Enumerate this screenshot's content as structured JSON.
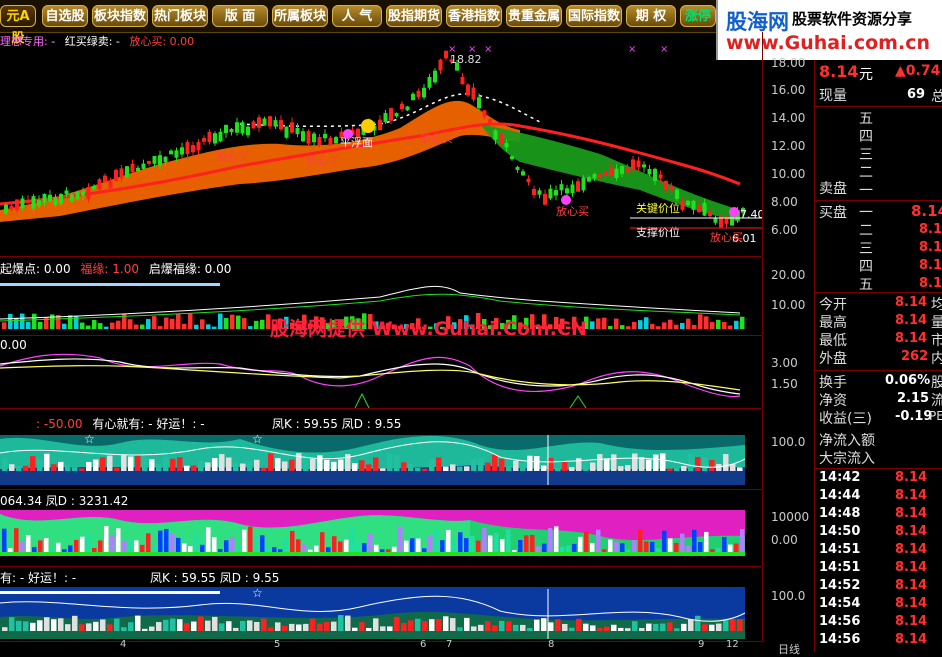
{
  "tabs": [
    "元A股",
    "自选股",
    "板块指数",
    "热门板块",
    "版 面",
    "所属板块",
    "人 气",
    "股指期货",
    "香港指数",
    "贵重金属",
    "国际指数",
    "期 权",
    "涨停"
  ],
  "logo": {
    "main": "股海网",
    "sub": "股票软件资源分享",
    "url": "www.Guhai.com.cn"
  },
  "main_chart": {
    "header": {
      "name": "理想专用:",
      "sep": "-",
      "item1": "红买绿卖:",
      "item1_val": "-",
      "item2": "放心买:",
      "item2_val": "0.00"
    },
    "y_ticks": [
      "18.00",
      "16.00",
      "14.00",
      "12.00",
      "10.00",
      "8.00",
      "6.00"
    ],
    "labels": {
      "peak": "18.82",
      "low": "6.01",
      "ping_fu_mian": "平浮面",
      "support": "支撑价位",
      "key": "关键价位",
      "key_val": "7.40",
      "buy1": "放心买",
      "buy2": "放心买",
      "buy3": "放心买",
      "buy4": "放心买",
      "buy5": "放心买"
    }
  },
  "panel2": {
    "h1": "起爆点: 0.00",
    "h2": "福缘: 1.00",
    "h3": "启爆福缘: 0.00",
    "y_ticks": [
      "20.00",
      "10.00"
    ]
  },
  "panel3": {
    "h1": "0.00",
    "y_ticks": [
      "3.00",
      "1.50"
    ]
  },
  "panel4": {
    "h1": ": -50.00",
    "h2": "有心就有: - 好运！: -",
    "h3": "凤K : 59.55  凤D : 9.55",
    "y_ticks": [
      "100.0"
    ]
  },
  "panel5": {
    "h1": "064.34  凤D : 3231.42",
    "y_ticks": [
      "10000",
      "0.00"
    ]
  },
  "panel6": {
    "h1": "有: - 好运！: -",
    "h2": "凤K : 59.55  凤D : 9.55",
    "y_ticks": [
      "100.0"
    ]
  },
  "watermark": "股海网提供 Www.Guhai.Com.CN",
  "x_axis": [
    "4",
    "5",
    "6",
    "7",
    "8",
    "9",
    "12"
  ],
  "bottom_right": "日线",
  "quote": {
    "price": "8.14",
    "price_unit": "元",
    "change": "▲0.74",
    "volume_label": "现量",
    "volume": "69",
    "volume_suffix": "总",
    "sell_levels": [
      "五",
      "四",
      "三",
      "二",
      "一"
    ],
    "sell_label": "卖盘",
    "buy_label": "买盘",
    "buy_levels": [
      "一",
      "二",
      "三",
      "四",
      "五"
    ],
    "buy_prices": [
      "8.14",
      "8.1",
      "8.1",
      "8.1",
      "8.1"
    ],
    "stats": [
      {
        "label": "今开",
        "value": "8.14",
        "suffix": "均"
      },
      {
        "label": "最高",
        "value": "8.14",
        "suffix": "量"
      },
      {
        "label": "最低",
        "value": "8.14",
        "suffix": "市"
      },
      {
        "label": "外盘",
        "value": "262",
        "suffix": "内"
      },
      {
        "label": "换手",
        "value": "0.06%",
        "suffix": "股"
      },
      {
        "label": "净资",
        "value": "2.15",
        "suffix": "流"
      },
      {
        "label": "收益(三)",
        "value": "-0.19",
        "suffix": "PE"
      }
    ],
    "flows": [
      "净流入额",
      "大宗流入"
    ],
    "ticks": [
      {
        "time": "14:42",
        "price": "8.14"
      },
      {
        "time": "14:44",
        "price": "8.14"
      },
      {
        "time": "14:48",
        "price": "8.14"
      },
      {
        "time": "14:50",
        "price": "8.14"
      },
      {
        "time": "14:51",
        "price": "8.14"
      },
      {
        "time": "14:51",
        "price": "8.14"
      },
      {
        "time": "14:52",
        "price": "8.14"
      },
      {
        "time": "14:54",
        "price": "8.14"
      },
      {
        "time": "14:56",
        "price": "8.14"
      },
      {
        "time": "14:56",
        "price": "8.14"
      }
    ]
  },
  "colors": {
    "up": "#ff3030",
    "down": "#00e0e0",
    "candle_up": "#ff2020",
    "candle_down": "#20e020",
    "accent": "#ffd400"
  }
}
